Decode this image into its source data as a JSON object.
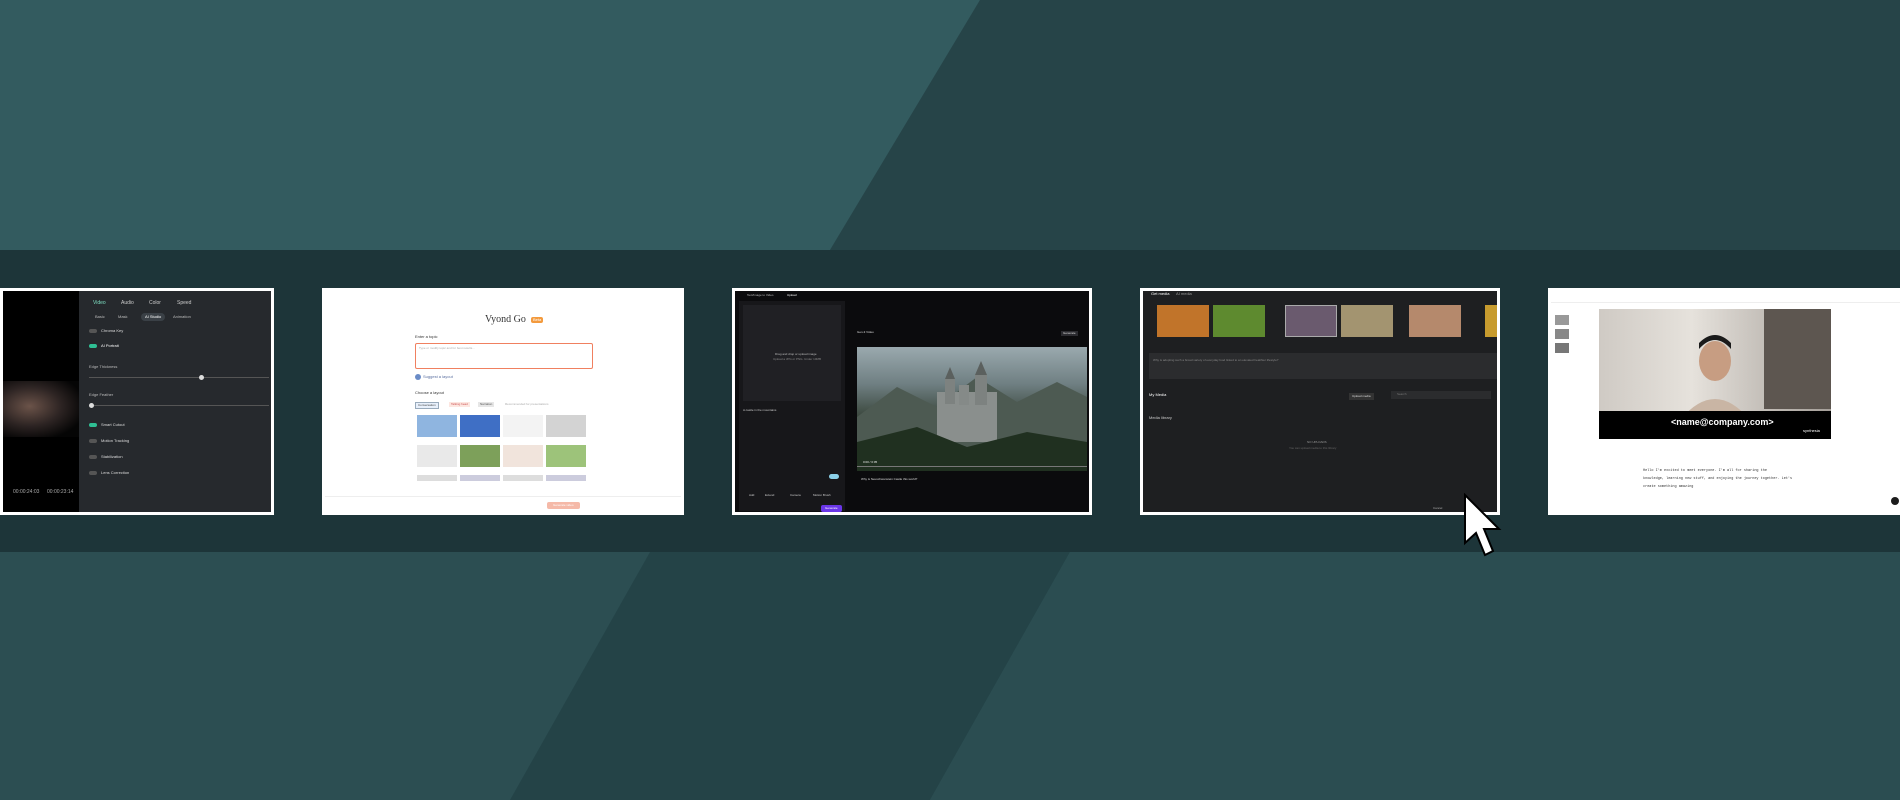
{
  "thumbnails": [
    {
      "name": "video-editor-properties",
      "tabs": [
        "Video",
        "Audio",
        "Color",
        "Speed"
      ],
      "subtabs": [
        "Basic",
        "Mask",
        "AI Studio",
        "Animation"
      ],
      "toggles": [
        "Chroma Key",
        "AI Portrait"
      ],
      "sliders": [
        "Edge Thickness",
        "Edge Feather"
      ],
      "toggles2": [
        "Smart Cutout",
        "Motion Tracking",
        "Stabilization",
        "Lens Correction"
      ],
      "time_current": "00:00:24:03",
      "time_total": "00:00:23:14"
    },
    {
      "name": "vyond-go",
      "title": "Vyond Go",
      "badge": "Beta",
      "topic_label": "Enter a topic",
      "topic_placeholder": "Type or modify topic and for best results...",
      "suggest": "Suggest a layout",
      "layout_label": "Choose a layout",
      "chips": [
        "Conversation",
        "Talking head",
        "Narration",
        "Recommended for presentations"
      ],
      "next": "Generate video"
    },
    {
      "name": "image-to-video",
      "tab1": "Text/Image to Video",
      "tab2": "Upload",
      "upload_hint": "Drag and drop or upload image",
      "upload_sub": "Upload a JPG or PNG. Under 10MB",
      "prompt_text": "A castle in the mountains",
      "video_title": "Gen-3 Video",
      "status": "Generate",
      "controls": [
        "Add",
        "Extend",
        "Camera",
        "Motion Brush"
      ],
      "generate": "Generate",
      "caption": "Why is Neuschwanstein Castle this world?",
      "time": "0:00 / 0:05"
    },
    {
      "name": "media-library",
      "tab1": "Get media",
      "tab2": "AI media",
      "question": "Why is adopting such a broad variety of everyday food linked to an elevated healthier lifestyle?",
      "my_media": "My Media",
      "upload": "Upload media",
      "search": "Search",
      "media_library": "Media library",
      "empty": "NO UPLOADS",
      "empty_sub": "You can upload media to this library",
      "cancel": "Cancel"
    },
    {
      "name": "avatar-presenter",
      "email": "<name@company.com>",
      "logo": "synthesia",
      "script_lines": [
        "Hello I'm excited to meet everyone. I'm all for sharing the",
        "knowledge, learning new stuff, and enjoying the journey together. Let's",
        "create something amazing"
      ]
    }
  ]
}
